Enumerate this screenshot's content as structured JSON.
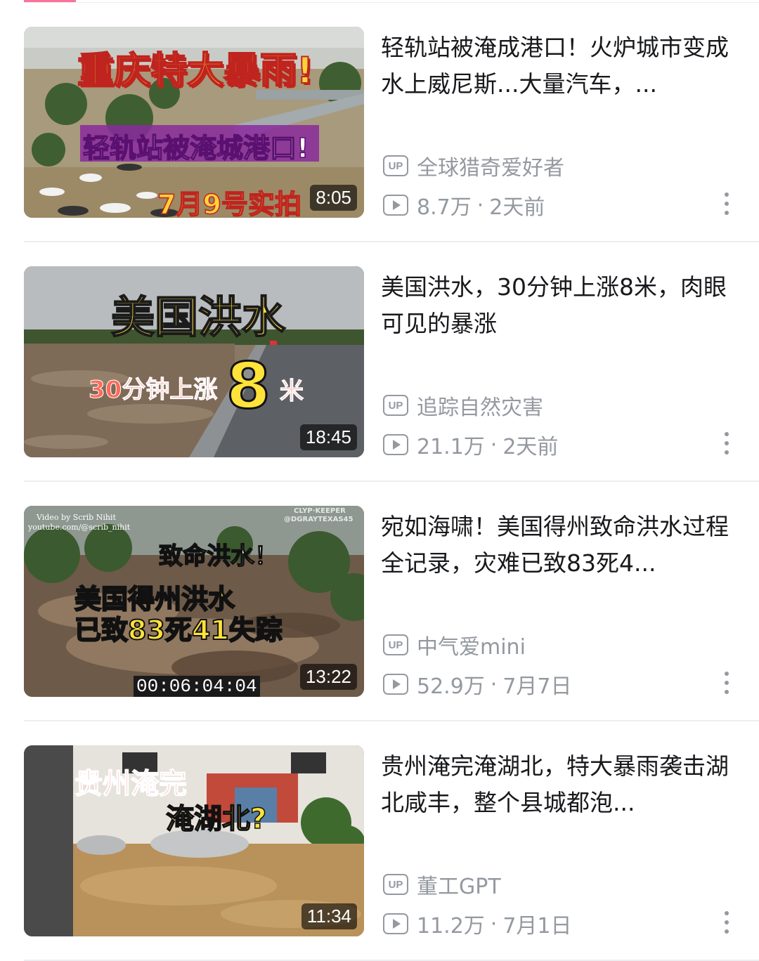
{
  "colors": {
    "accent": "#fb7299",
    "meta": "#9499a0",
    "title": "#18191c"
  },
  "videos": [
    {
      "title": "轻轨站被淹成港口！火炉城市变成水上威尼斯...大量汽车，...",
      "duration": "8:05",
      "author": "全球猎奇爱好者",
      "views": "8.7万",
      "date": "2天前",
      "thumb_text": [
        "重庆特大暴雨!",
        "轻轨站被淹城港口!",
        "7月9号实拍"
      ]
    },
    {
      "title": "美国洪水，30分钟上涨8米，肉眼可见的暴涨",
      "duration": "18:45",
      "author": "追踪自然灾害",
      "views": "21.1万",
      "date": "2天前",
      "thumb_text": [
        "美国洪水",
        "30分钟上涨",
        "8",
        "米"
      ]
    },
    {
      "title": "宛如海啸！美国得州致命洪水过程全记录，灾难已致83死4...",
      "duration": "13:22",
      "author": "中气爱mini",
      "views": "52.9万",
      "date": "7月7日",
      "thumb_text": [
        "致命洪水！",
        "美国得州洪水",
        "已致83死41失踪",
        "00:06:04:04",
        "Video by Scrib Nihit",
        "youtube.com/@scrib_nihit",
        "CLYP·KEEPER",
        "@DGRAYTEXAS45"
      ]
    },
    {
      "title": "贵州淹完淹湖北，特大暴雨袭击湖北咸丰，整个县城都泡...",
      "duration": "11:34",
      "author": "董工GPT",
      "views": "11.2万",
      "date": "7月1日",
      "thumb_text": [
        "贵州淹完",
        "淹湖北?"
      ]
    }
  ],
  "labels": {
    "up_badge": "UP",
    "dot_separator": "·"
  }
}
